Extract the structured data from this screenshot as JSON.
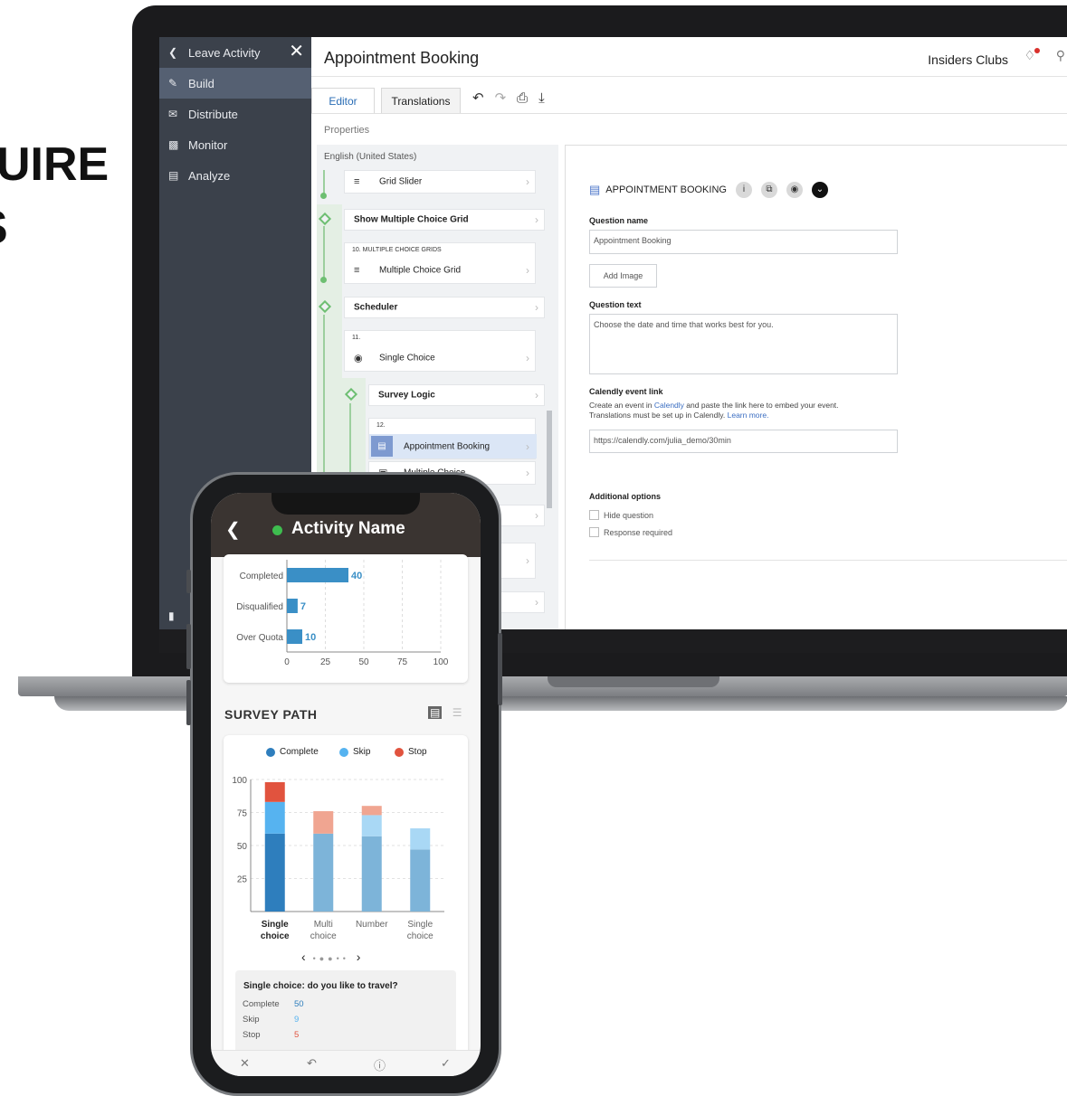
{
  "hero_text": {
    "line1": "UIRE",
    "line2": "S"
  },
  "sidebar": {
    "back_label": "Leave Activity",
    "items": [
      {
        "label": "Build",
        "active": true
      },
      {
        "label": "Distribute"
      },
      {
        "label": "Monitor"
      },
      {
        "label": "Analyze"
      }
    ]
  },
  "header": {
    "title": "Appointment Booking",
    "org": "Insiders Clubs"
  },
  "tabs": {
    "editor": "Editor",
    "translations": "Translations"
  },
  "properties_label": "Properties",
  "tree": {
    "language": "English (United States)",
    "grid_slider": "Grid Slider",
    "show_multiple_choice_grid": "Show Multiple Choice Grid",
    "tag_10": "10. MULTIPLE CHOICE GRIDS",
    "multiple_choice_grid": "Multiple Choice Grid",
    "scheduler": "Scheduler",
    "tag_11": "11.",
    "single_choice": "Single Choice",
    "survey_logic": "Survey Logic",
    "tag_12": "12.",
    "appointment_booking": "Appointment Booking",
    "multiple_choice": "Multiple Choice"
  },
  "form": {
    "heading": "APPOINTMENT BOOKING",
    "question_name_label": "Question name",
    "question_name_value": "Appointment Booking",
    "add_image": "Add Image",
    "question_text_label": "Question text",
    "question_text_value": "Choose the date and time that works best for you.",
    "calendly_label": "Calendly event link",
    "help_1": "Create an event in",
    "help_link": "Calendly",
    "help_2": "and paste the link here to embed your event.",
    "help_3": "Translations must be set up in Calendly.",
    "help_learn": "Learn more.",
    "calendly_value": "https://calendly.com/julia_demo/30min",
    "additional_label": "Additional options",
    "hide_question": "Hide question",
    "response_required": "Response required"
  },
  "phone": {
    "title": "Activity Name",
    "survey_path_title": "SURVEY PATH",
    "legend": {
      "complete": "Complete",
      "skip": "Skip",
      "stop": "Stop"
    },
    "detail": {
      "question": "Single choice: do you like to travel?",
      "complete_label": "Complete",
      "complete_value": "50",
      "skip_label": "Skip",
      "skip_value": "9",
      "stop_label": "Stop",
      "stop_value": "5"
    }
  },
  "colors": {
    "complete": "#2e7ebd",
    "skip": "#56b3f0",
    "stop": "#e1533e",
    "bar": "#3a8fc6"
  },
  "chart_data": [
    {
      "type": "bar",
      "orientation": "horizontal",
      "categories": [
        "Completed",
        "Disqualified",
        "Over Quota"
      ],
      "values": [
        40,
        7,
        10
      ],
      "xlim": [
        0,
        100
      ],
      "xticks": [
        0,
        25,
        50,
        75,
        100
      ]
    },
    {
      "type": "bar",
      "stacked": true,
      "categories": [
        "Single choice",
        "Multi choice",
        "Number",
        "Single choice"
      ],
      "series": [
        {
          "name": "Complete",
          "values": [
            59,
            59,
            57,
            47
          ]
        },
        {
          "name": "Skip",
          "values": [
            24,
            0,
            16,
            16
          ]
        },
        {
          "name": "Stop",
          "values": [
            15,
            17,
            7,
            0
          ]
        }
      ],
      "ylim": [
        0,
        100
      ],
      "yticks": [
        25,
        50,
        75,
        100
      ]
    }
  ]
}
